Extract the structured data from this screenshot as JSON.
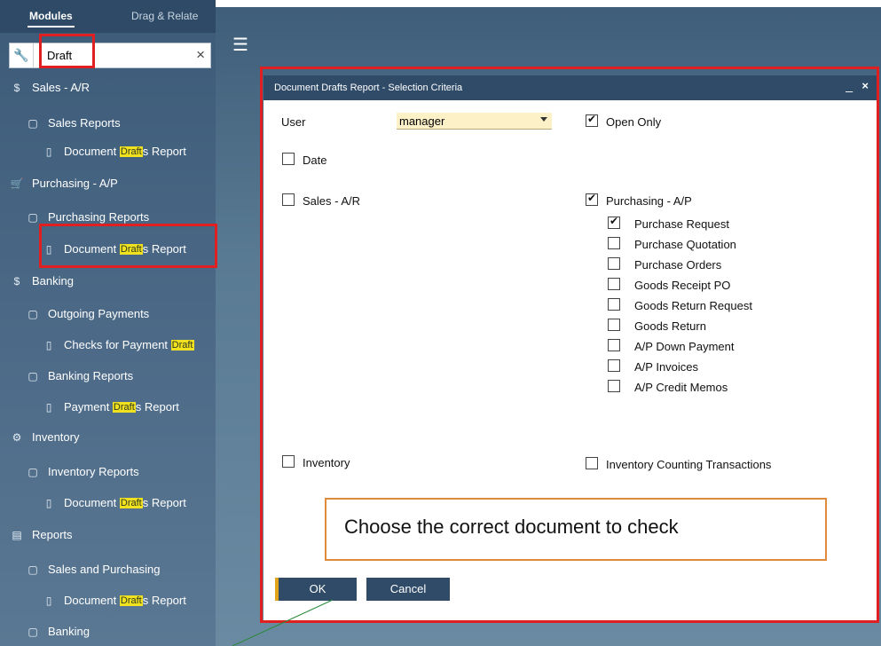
{
  "sidebar": {
    "tabs": {
      "modules": "Modules",
      "drag_relate": "Drag & Relate"
    },
    "search": {
      "value": "Draft",
      "clear": "×"
    },
    "highlight": "Draft",
    "items": [
      {
        "icon": "$",
        "label": "Sales - A/R"
      },
      {
        "icon": "▢",
        "label": "Sales Reports"
      },
      {
        "icon": "▯",
        "pre": "Document ",
        "post": "s Report"
      },
      {
        "icon": "🛒",
        "label": "Purchasing - A/P"
      },
      {
        "icon": "▢",
        "label": "Purchasing Reports"
      },
      {
        "icon": "▯",
        "pre": "Document ",
        "post": "s Report"
      },
      {
        "icon": "$",
        "label": "Banking"
      },
      {
        "icon": "▢",
        "label": "Outgoing Payments"
      },
      {
        "icon": "▯",
        "pre": "Checks for Payment ",
        "post": ""
      },
      {
        "icon": "▢",
        "label": "Banking Reports"
      },
      {
        "icon": "▯",
        "pre": "Payment ",
        "post": "s Report"
      },
      {
        "icon": "⚙",
        "label": "Inventory"
      },
      {
        "icon": "▢",
        "label": "Inventory Reports"
      },
      {
        "icon": "▯",
        "pre": "Document ",
        "post": "s Report"
      },
      {
        "icon": "▤",
        "label": "Reports"
      },
      {
        "icon": "▢",
        "label": "Sales and Purchasing"
      },
      {
        "icon": "▯",
        "pre": "Document ",
        "post": "s Report"
      },
      {
        "icon": "▢",
        "label": "Banking"
      }
    ]
  },
  "dialog": {
    "title": "Document Drafts Report - Selection Criteria",
    "minimize": "_",
    "close": "×",
    "user_label": "User",
    "user_value": "manager",
    "open_only": "Open Only",
    "date": "Date",
    "sales_ar": "Sales - A/R",
    "purchasing_ap": "Purchasing - A/P",
    "purchasing_options": [
      {
        "label": "Purchase Request",
        "checked": true
      },
      {
        "label": "Purchase Quotation",
        "checked": false
      },
      {
        "label": "Purchase Orders",
        "checked": false
      },
      {
        "label": "Goods Receipt PO",
        "checked": false
      },
      {
        "label": "Goods Return Request",
        "checked": false
      },
      {
        "label": "Goods Return",
        "checked": false
      },
      {
        "label": "A/P Down Payment",
        "checked": false
      },
      {
        "label": "A/P Invoices",
        "checked": false
      },
      {
        "label": "A/P Credit Memos",
        "checked": false
      }
    ],
    "inventory": "Inventory",
    "inventory_counting": "Inventory Counting Transactions",
    "ok": "OK",
    "cancel": "Cancel"
  },
  "callout": "Choose the correct document to check",
  "colors": {
    "accent": "#2f4b68",
    "annotation_red": "#e02020",
    "highlight": "#f1e11e",
    "callout_border": "#e08a3c"
  }
}
